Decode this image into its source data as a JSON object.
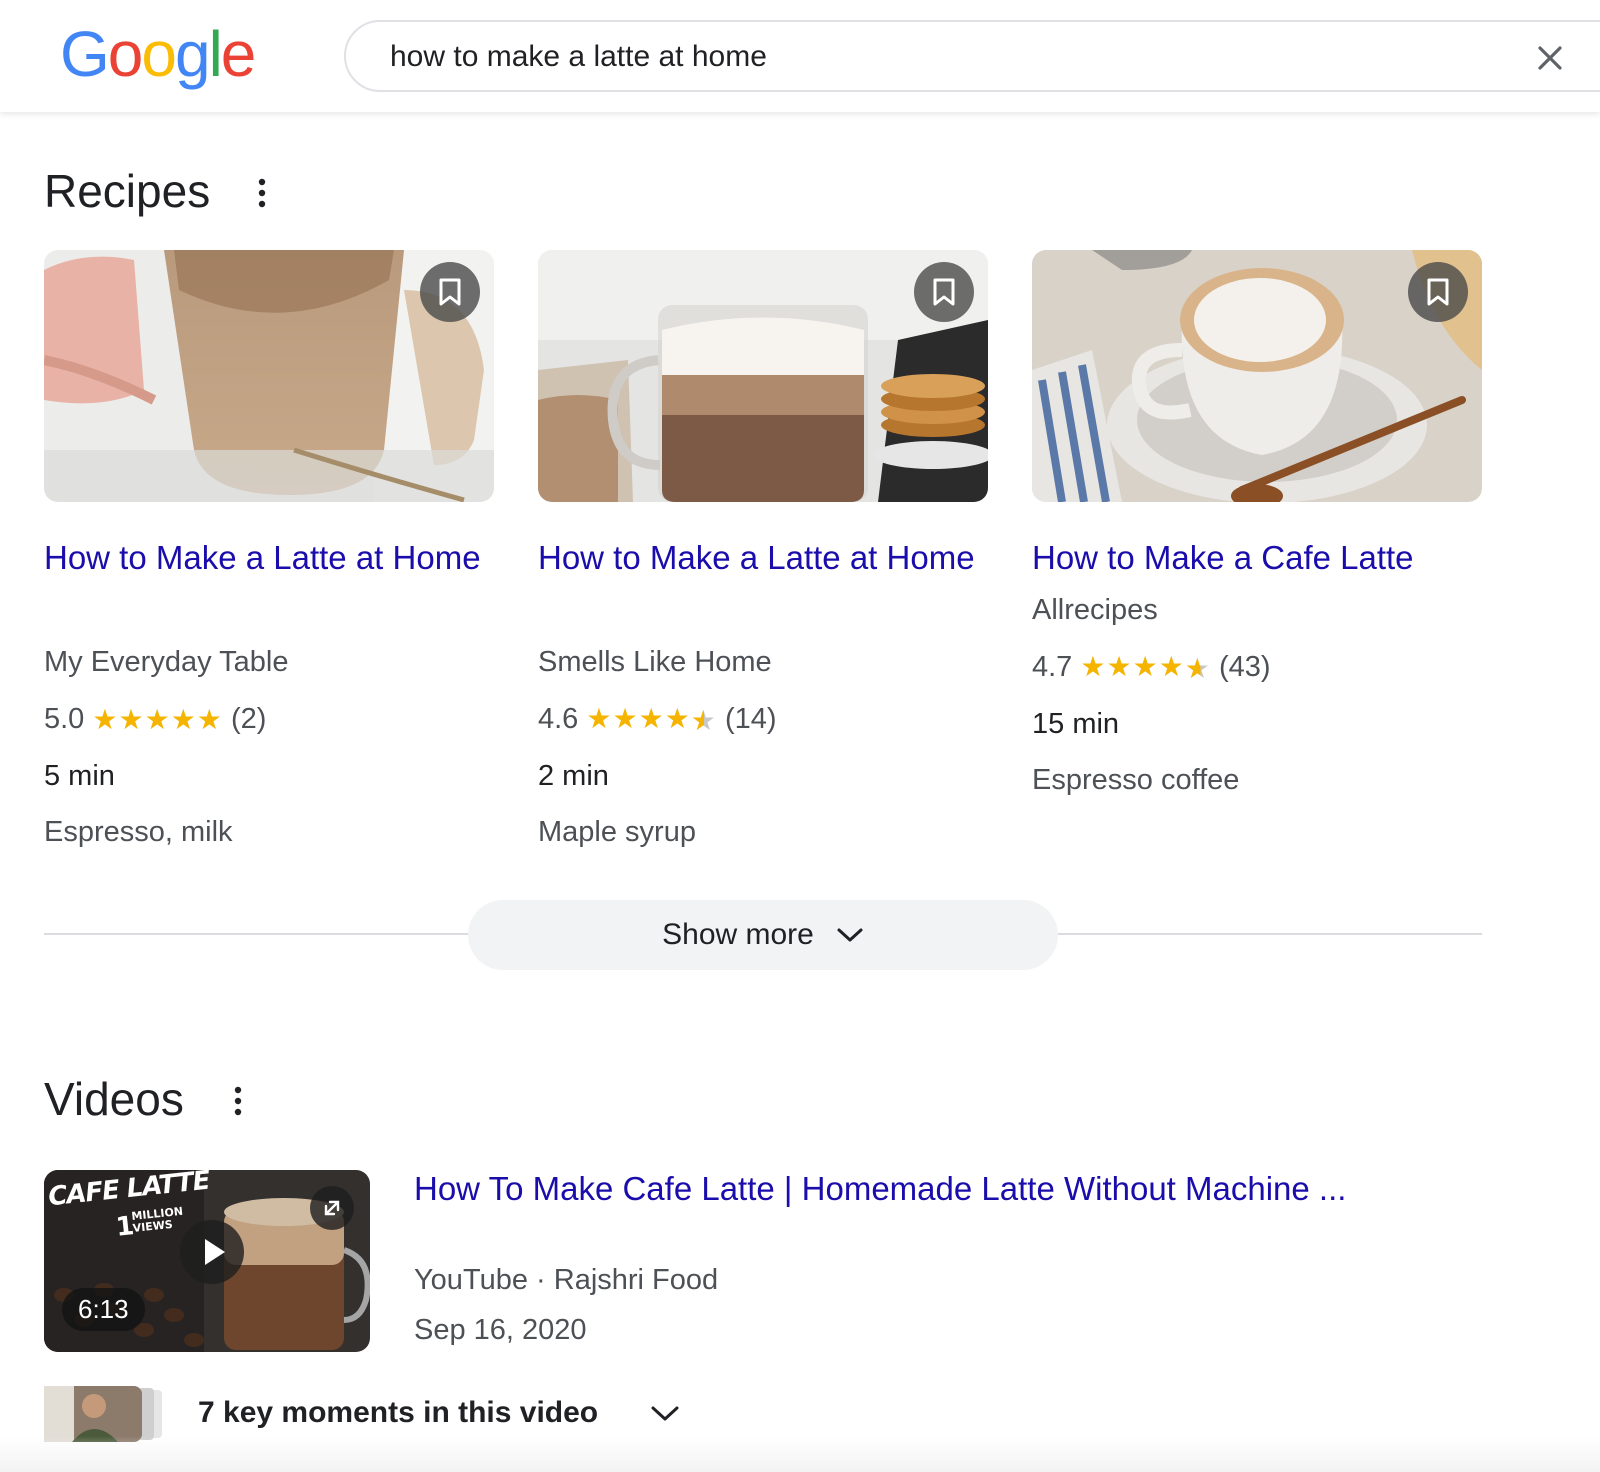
{
  "header": {
    "logo_letters": [
      "G",
      "o",
      "o",
      "g",
      "l",
      "e"
    ],
    "logo_colors": [
      "#4285F4",
      "#EA4335",
      "#FBBC05",
      "#4285F4",
      "#34A853",
      "#EA4335"
    ],
    "search_query": "how to make a latte at home"
  },
  "recipes": {
    "title": "Recipes",
    "items": [
      {
        "title": "How to Make a Latte at Home",
        "source": "My Everyday Table",
        "rating": "5.0",
        "stars": 5,
        "reviews": "(2)",
        "time": "5 min",
        "ingredients": "Espresso, milk"
      },
      {
        "title": "How to Make a Latte at Home",
        "source": "Smells Like Home",
        "rating": "4.6",
        "stars": 4.5,
        "reviews": "(14)",
        "time": "2 min",
        "ingredients": "Maple syrup"
      },
      {
        "title": "How to Make a Cafe Latte",
        "source": "Allrecipes",
        "rating": "4.7",
        "stars": 4.5,
        "reviews": "(43)",
        "time": "15 min",
        "ingredients": "Espresso coffee"
      }
    ],
    "show_more_label": "Show more"
  },
  "videos": {
    "title": "Videos",
    "items": [
      {
        "title": "How To Make Cafe Latte | Homemade Latte Without Machine ...",
        "platform": "YouTube",
        "separator": " · ",
        "channel": "Rajshri Food",
        "date": "Sep 16, 2020",
        "duration": "6:13",
        "thumb_text_top": "CAFE LATTE",
        "thumb_text_mid": "1",
        "thumb_text_badge": "MILLION VIEWS",
        "key_moments_label": "7 key moments in this video"
      }
    ]
  },
  "colors": {
    "link": "#1a0dab",
    "star": "#f4b400",
    "text": "#202124",
    "muted": "#4d5156"
  }
}
